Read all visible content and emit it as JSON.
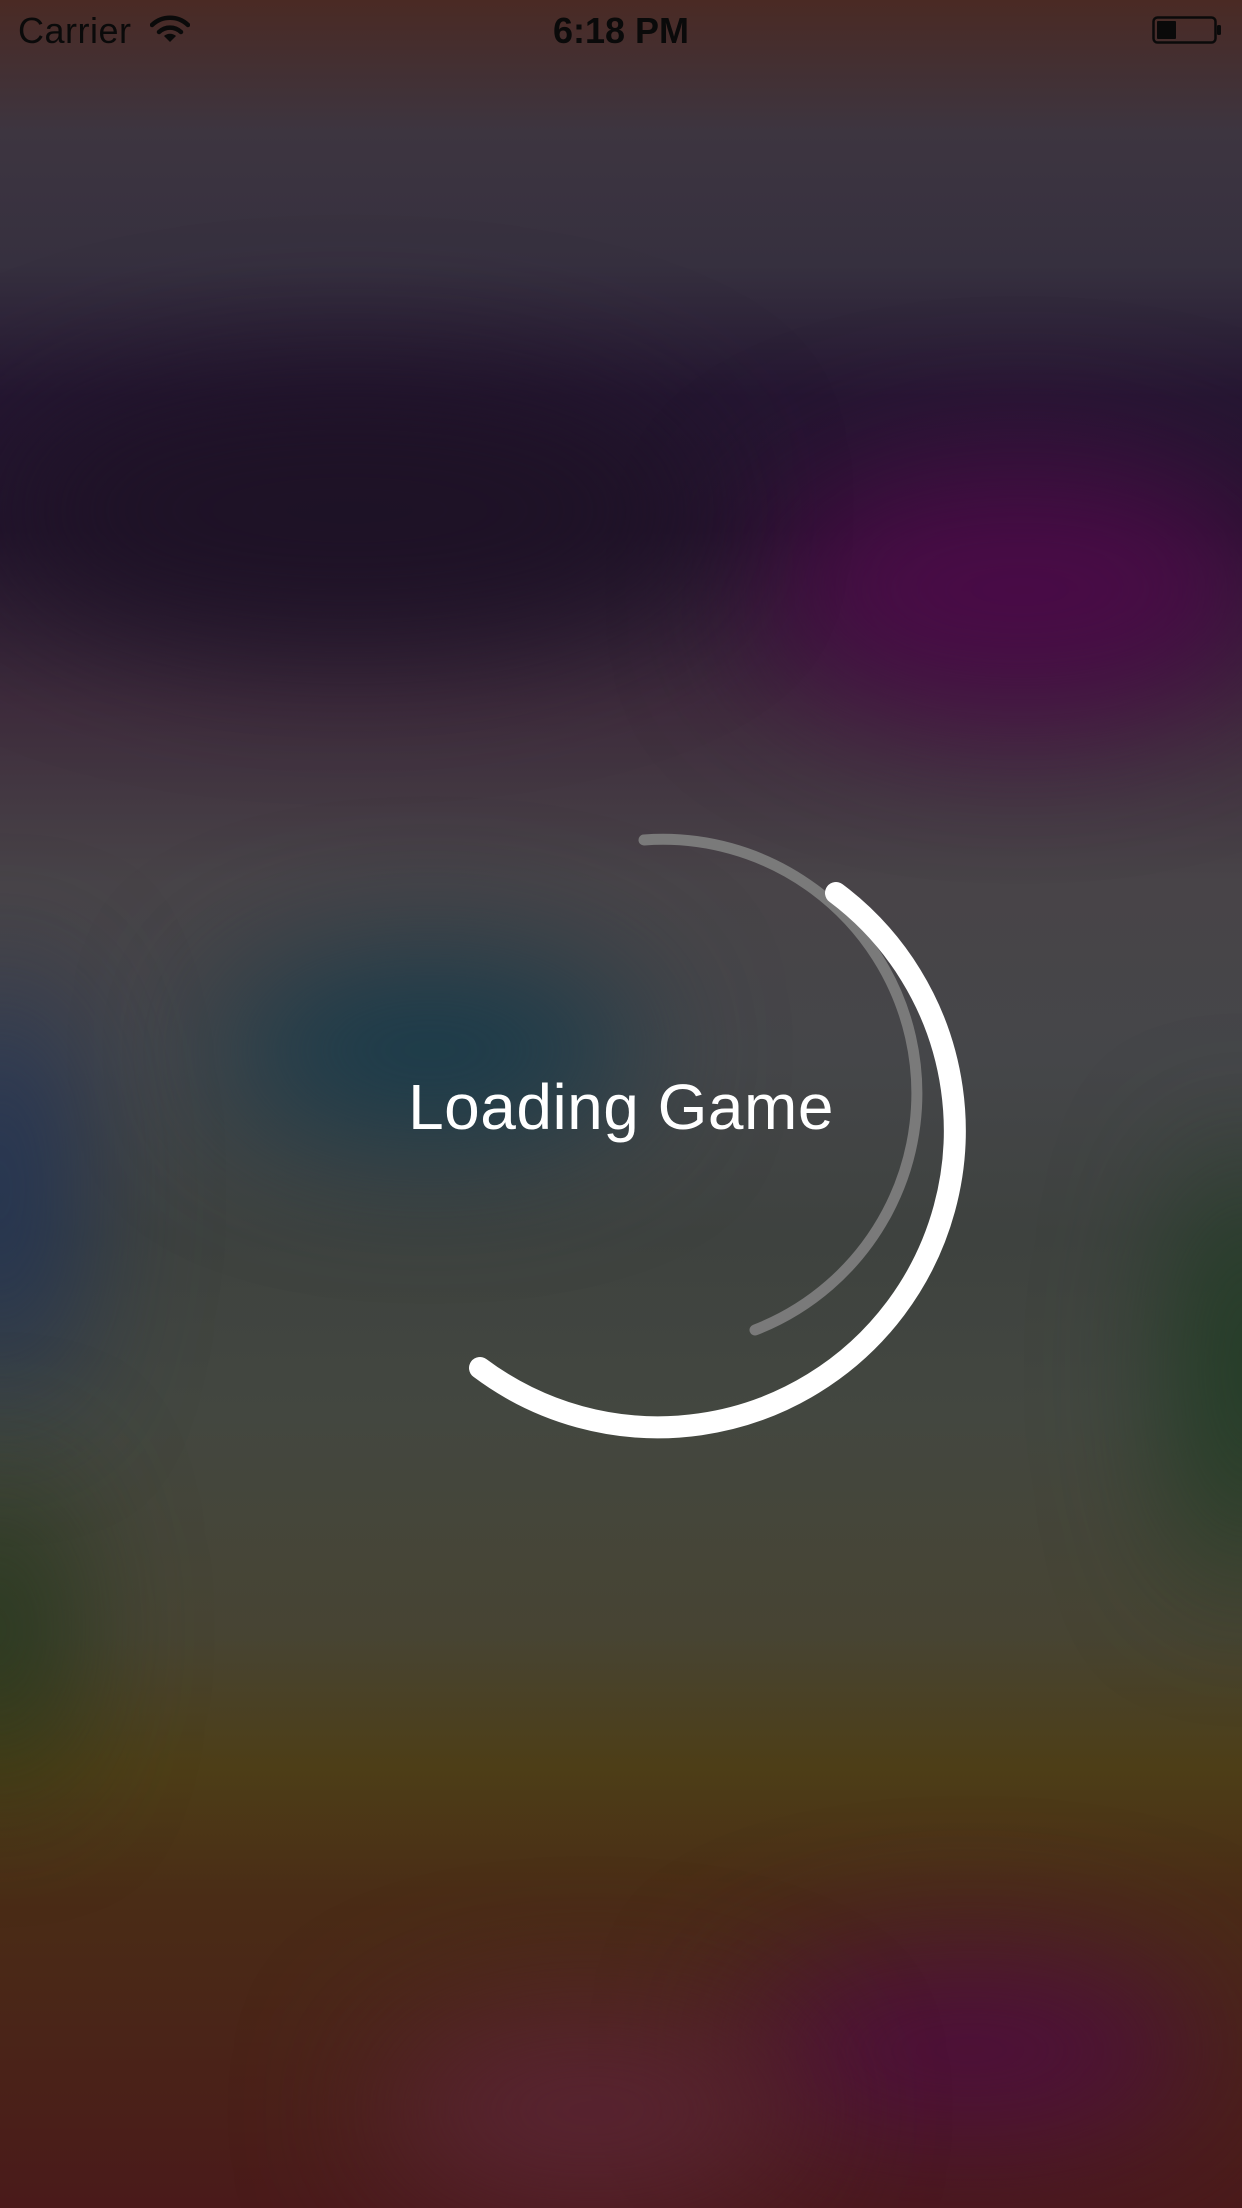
{
  "status_bar": {
    "carrier": "Carrier",
    "time": "6:18 PM",
    "wifi_icon": "wifi-icon",
    "battery_icon": "battery-icon"
  },
  "loader": {
    "label": "Loading Game",
    "spinner_icon": "loading-spinner-icon"
  },
  "colors": {
    "spinner_outer": "#ffffff",
    "spinner_inner": "#7a7a7a",
    "text": "#ffffff",
    "status_text": "#0a0a0a"
  }
}
